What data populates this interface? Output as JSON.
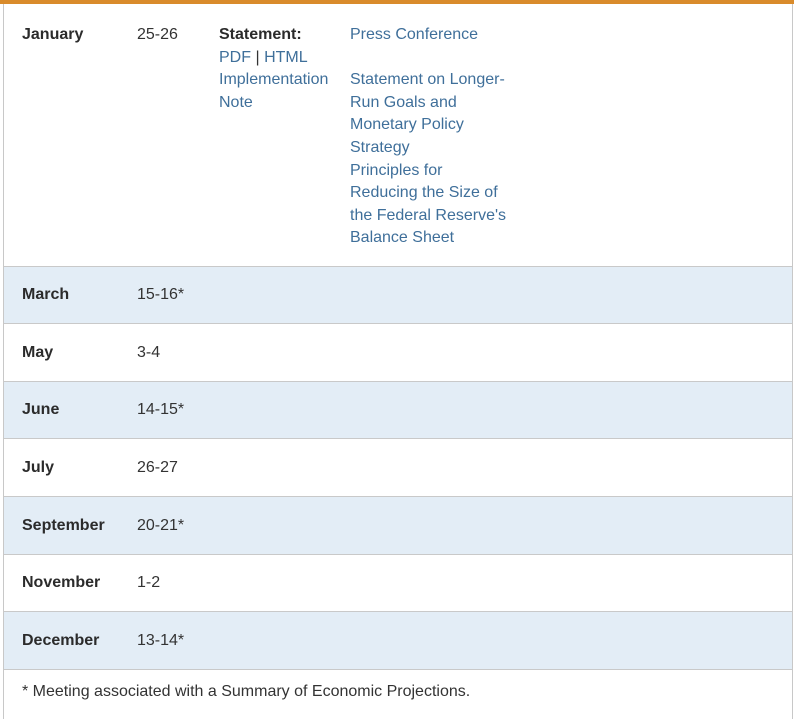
{
  "accent_color": "#d98b2b",
  "link_color": "#3f6f9a",
  "shaded_row_color": "#e3edf6",
  "january": {
    "month": "January",
    "dates": "25-26",
    "statement_label": "Statement:",
    "pdf_link": "PDF",
    "separator": "|",
    "html_link": "HTML",
    "implementation_note_line1": "Implementation",
    "implementation_note_line2": "Note",
    "press_conference": "Press Conference",
    "longer_run_lines": [
      "Statement on Longer-",
      "Run Goals and",
      "Monetary Policy",
      "Strategy"
    ],
    "principles_lines": [
      "Principles for",
      "Reducing the Size of",
      "the Federal Reserve's",
      "Balance Sheet"
    ]
  },
  "meetings": [
    {
      "month": "March",
      "dates": "15-16*"
    },
    {
      "month": "May",
      "dates": "3-4"
    },
    {
      "month": "June",
      "dates": "14-15*"
    },
    {
      "month": "July",
      "dates": "26-27"
    },
    {
      "month": "September",
      "dates": "20-21*"
    },
    {
      "month": "November",
      "dates": "1-2"
    },
    {
      "month": "December",
      "dates": "13-14*"
    }
  ],
  "footnote": "* Meeting associated with a Summary of Economic Projections."
}
